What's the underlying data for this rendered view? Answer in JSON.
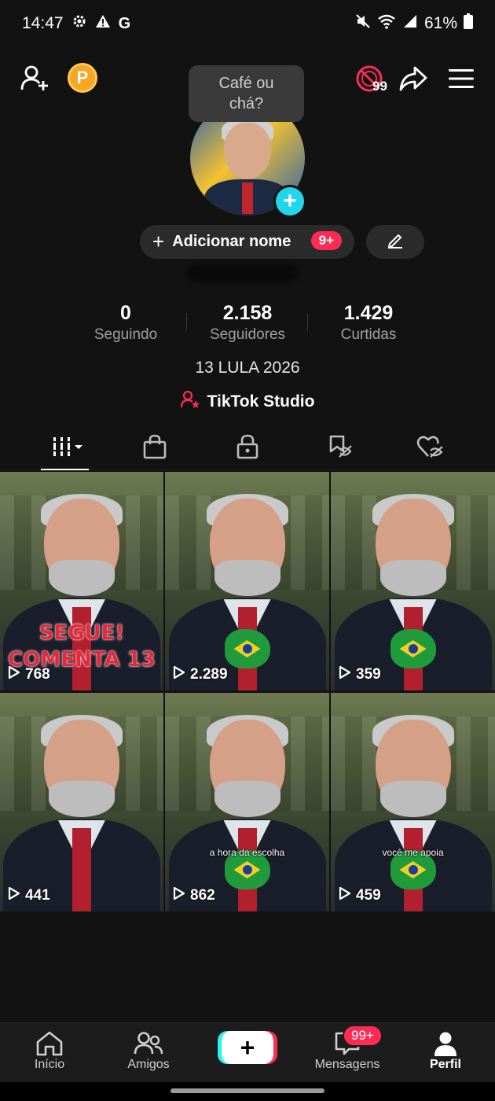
{
  "status_bar": {
    "time": "14:47",
    "left_icons": [
      "gear-icon",
      "warning-icon",
      "google-icon"
    ],
    "right_icons": [
      "mute-icon",
      "wifi-icon",
      "signal-icon",
      "battery-icon"
    ],
    "battery": "61%"
  },
  "top_bar": {
    "add_friend_icon": "add-person-icon",
    "coin_label": "P",
    "live_badge_count": "99",
    "share_icon": "share-icon",
    "menu_icon": "hamburger-menu-icon"
  },
  "tooltip": {
    "text": "Café ou chá?"
  },
  "profile": {
    "add_name_label": "Adicionar nome",
    "add_name_badge": "9+",
    "bio": "13 LULA 2026",
    "studio_label": "TikTok Studio"
  },
  "stats": [
    {
      "value": "0",
      "label": "Seguindo"
    },
    {
      "value": "2.158",
      "label": "Seguidores"
    },
    {
      "value": "1.429",
      "label": "Curtidas"
    }
  ],
  "tabs": [
    "videos-grid-icon",
    "shop-bag-icon",
    "lock-icon",
    "saved-tag-icon",
    "liked-heart-icon"
  ],
  "videos": [
    {
      "views": "768",
      "overlay": [
        "SEGUE!",
        "COMENTA 13"
      ],
      "caption": "",
      "flag": false
    },
    {
      "views": "2.289",
      "overlay": [],
      "caption": "",
      "flag": true
    },
    {
      "views": "359",
      "overlay": [],
      "caption": "",
      "flag": true
    },
    {
      "views": "441",
      "overlay": [],
      "caption": "",
      "flag": false
    },
    {
      "views": "862",
      "overlay": [],
      "caption": "a hora da escolha",
      "flag": true
    },
    {
      "views": "459",
      "overlay": [],
      "caption": "você me apoia",
      "flag": true
    }
  ],
  "bottom_nav": {
    "home": "Início",
    "friends": "Amigos",
    "create": "+",
    "messages": "Mensagens",
    "messages_badge": "99+",
    "profile": "Perfil"
  },
  "colors": {
    "background": "#121212",
    "accent_pink": "#fe2c55",
    "accent_cyan": "#25f4ee",
    "coin": "#f5a623"
  }
}
